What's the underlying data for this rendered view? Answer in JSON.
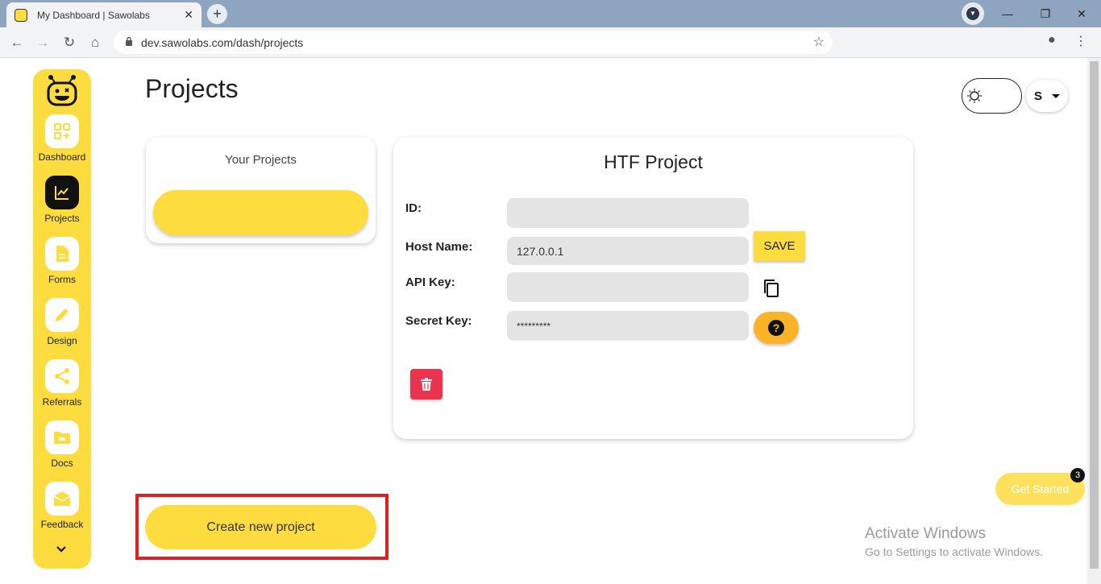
{
  "browser": {
    "tab_title": "My Dashboard | Sawolabs",
    "close_glyph": "✕",
    "new_tab_glyph": "+",
    "url": "dev.sawolabs.com/dash/projects",
    "back_glyph": "←",
    "forward_glyph": "→",
    "reload_glyph": "↻",
    "home_glyph": "⌂",
    "star_glyph": "☆",
    "menu_glyph": "⋮",
    "minimize_glyph": "—",
    "restore_glyph": "❐",
    "window_close_glyph": "✕",
    "profile_glyph": "▼",
    "account_glyph": "●"
  },
  "sidebar": {
    "items": [
      {
        "label": "Dashboard",
        "icon": "dashboard-icon"
      },
      {
        "label": "Projects",
        "icon": "projects-chart-icon"
      },
      {
        "label": "Forms",
        "icon": "forms-document-icon"
      },
      {
        "label": "Design",
        "icon": "design-pencil-icon"
      },
      {
        "label": "Referrals",
        "icon": "share-icon"
      },
      {
        "label": "Docs",
        "icon": "docs-folder-icon"
      },
      {
        "label": "Feedback",
        "icon": "feedback-mail-icon"
      }
    ],
    "expand_glyph": "⌄"
  },
  "page": {
    "title": "Projects"
  },
  "header": {
    "user_initial": "S"
  },
  "projects_list": {
    "heading": "Your Projects"
  },
  "project_detail": {
    "heading": "HTF Project",
    "id_label": "ID:",
    "host_label": "Host Name:",
    "host_value": "127.0.0.1",
    "api_label": "API Key:",
    "secret_label": "Secret Key:",
    "secret_value": "*********",
    "save_label": "SAVE",
    "help_glyph": "?"
  },
  "create_button_label": "Create new project",
  "get_started": {
    "label": "Get Started",
    "badge": "3"
  },
  "watermark": {
    "line1": "Activate Windows",
    "line2": "Go to Settings to activate Windows."
  },
  "colors": {
    "accent": "#fddc3f",
    "delete": "#e8344e",
    "help": "#fbb428",
    "highlight": "#e02020"
  }
}
